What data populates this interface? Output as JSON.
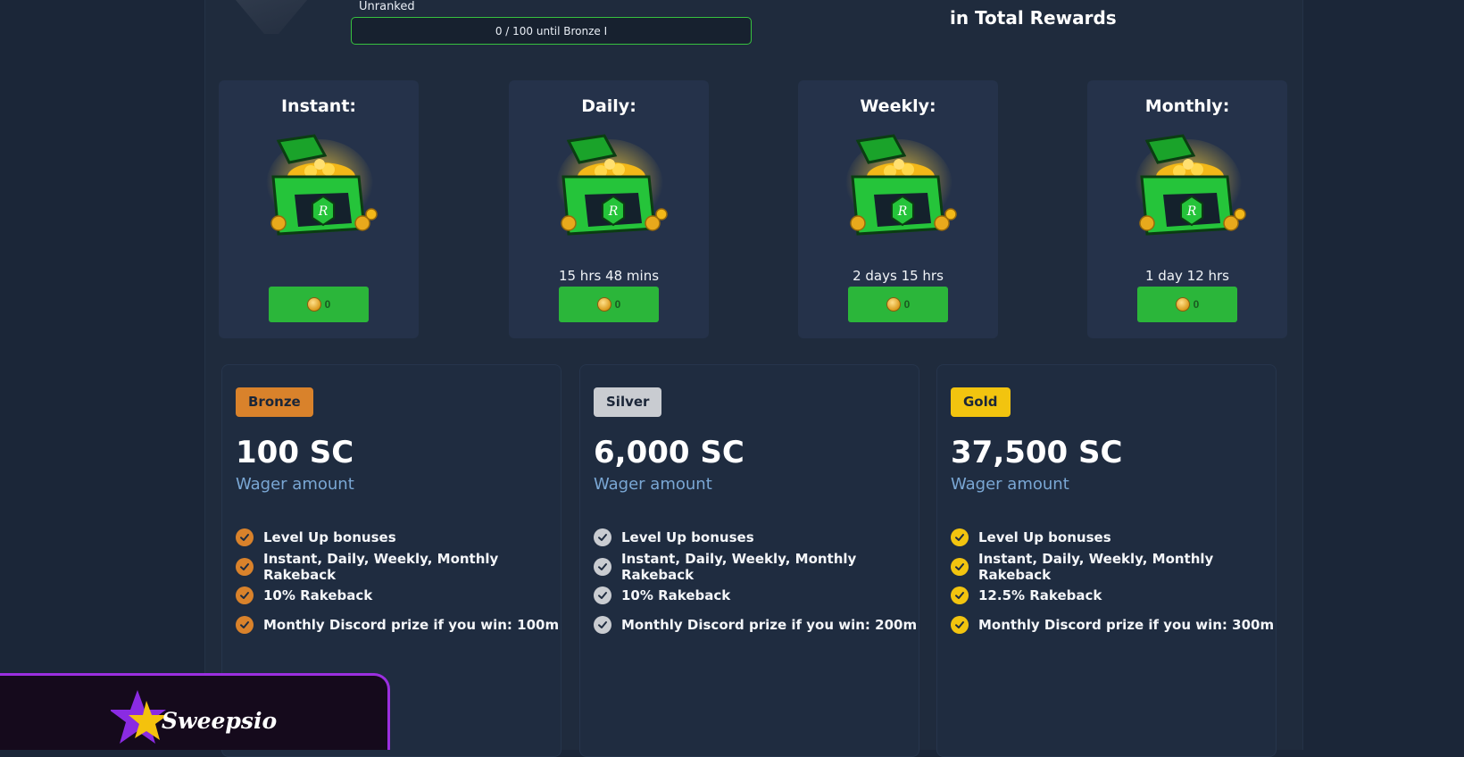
{
  "rank": {
    "label": "Unranked",
    "progress_text": "0 / 100 until Bronze I",
    "progress_fraction": 0,
    "progress_color": "#37c13f"
  },
  "total_rewards_label": "in Total Rewards",
  "reward_chests": [
    {
      "title": "Instant:",
      "timer": "",
      "claim_amount": "0",
      "icon": "treasure-chest-icon"
    },
    {
      "title": "Daily:",
      "timer": "15 hrs 48 mins",
      "claim_amount": "0",
      "icon": "treasure-chest-icon"
    },
    {
      "title": "Weekly:",
      "timer": "2 days 15 hrs",
      "claim_amount": "0",
      "icon": "treasure-chest-icon"
    },
    {
      "title": "Monthly:",
      "timer": "1 day 12 hrs",
      "claim_amount": "0",
      "icon": "treasure-chest-icon"
    }
  ],
  "tiers": [
    {
      "badge": "Bronze",
      "badge_color": "#d9822b",
      "amount": "100 SC",
      "wager_label": "Wager amount",
      "check_color": "#d9822b",
      "features": [
        "Level Up bonuses",
        "Instant, Daily, Weekly, Monthly Rakeback",
        "10% Rakeback",
        "Monthly Discord prize if you win: 100m"
      ]
    },
    {
      "badge": "Silver",
      "badge_color": "#c9ccd1",
      "amount": "6,000 SC",
      "wager_label": "Wager amount",
      "check_color": "#c9ccd1",
      "features": [
        "Level Up bonuses",
        "Instant, Daily, Weekly, Monthly Rakeback",
        "10% Rakeback",
        "Monthly Discord prize if you win: 200m"
      ]
    },
    {
      "badge": "Gold",
      "badge_color": "#f2c40f",
      "amount": "37,500 SC",
      "wager_label": "Wager amount",
      "check_color": "#f2c40f",
      "features": [
        "Level Up bonuses",
        "Instant, Daily, Weekly, Monthly Rakeback",
        "12.5% Rakeback",
        "Monthly Discord prize if you win: 300m"
      ]
    }
  ],
  "brand": {
    "name": "Sweepsio",
    "accent": "#9b2fe0",
    "logo_icon": "star-logo-icon"
  }
}
